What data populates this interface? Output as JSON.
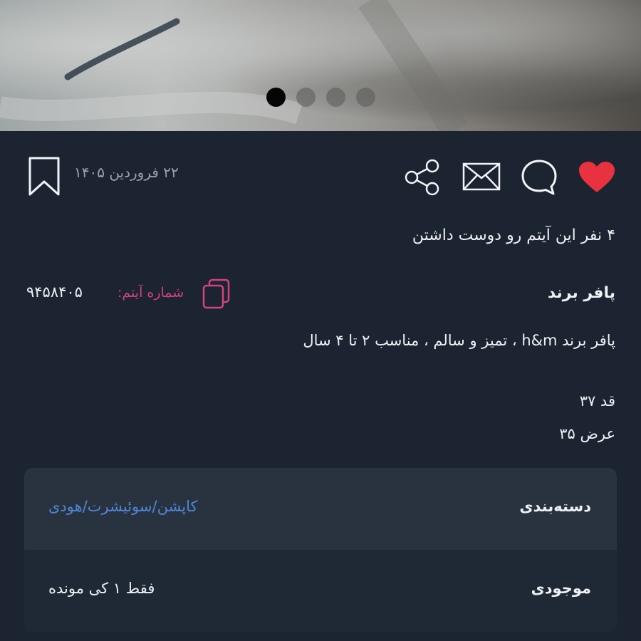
{
  "gallery": {
    "image_alt": "product-photo",
    "slides_count": 4,
    "active_slide": 1
  },
  "actions": {
    "like_icon": "heart-icon",
    "comment_icon": "comment-bubble-icon",
    "message_icon": "envelope-icon",
    "share_icon": "share-icon",
    "bookmark_icon": "bookmark-icon",
    "like_color": "#e8323f"
  },
  "post": {
    "date": "۲۲ فروردین ۱۴۰۵",
    "likes_text": "۴ نفر این آیتم رو دوست داشتن",
    "title": "پافر برند",
    "item_number_label": "شماره آیتم:",
    "item_number": "۹۴۵۸۴۰۵",
    "description": "پافر برند h&m ، تمیز و سالم ، مناسب ۲ تا ۴ سال",
    "height": "قد ۳۷",
    "width": "عرض ۳۵"
  },
  "details": {
    "category_label": "دسته‌بندی",
    "category_value": "کاپشن/سوئیشرت/هودی",
    "stock_label": "موجودی",
    "stock_value": "فقط ۱ کی مونده"
  },
  "colors": {
    "background": "#1b2430",
    "accent_pink": "#d6417f",
    "link_blue": "#4e86d6"
  }
}
